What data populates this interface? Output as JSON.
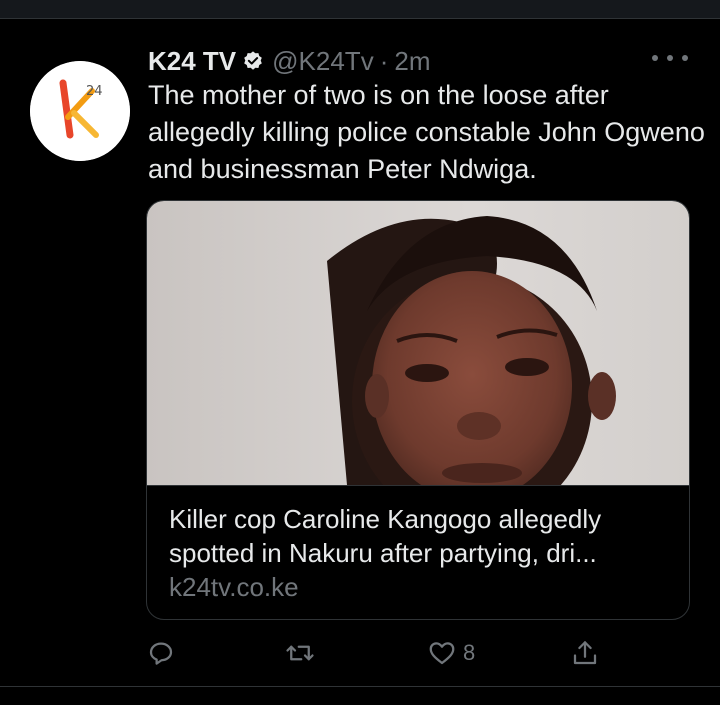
{
  "tweet": {
    "display_name": "K24 TV",
    "handle": "@K24Tv",
    "separator": "·",
    "time": "2m",
    "text": "The mother of two is on the loose after allegedly killing police constable John Ogweno and businessman Peter Ndwiga.",
    "avatar_logo": "K24",
    "avatar_logo_sup": "24"
  },
  "card": {
    "title": "Killer cop Caroline Kangogo allegedly spotted in Nakuru after partying, dri...",
    "domain": "k24tv.co.ke"
  },
  "actions": {
    "reply_icon": "reply-icon",
    "retweet_icon": "retweet-icon",
    "like_icon": "heart-icon",
    "like_count": "8",
    "share_icon": "share-icon"
  },
  "colors": {
    "background": "#000000",
    "text": "#e7e9ea",
    "muted": "#71767b",
    "border": "#2f3336",
    "brand_orange": "#f39c12"
  }
}
